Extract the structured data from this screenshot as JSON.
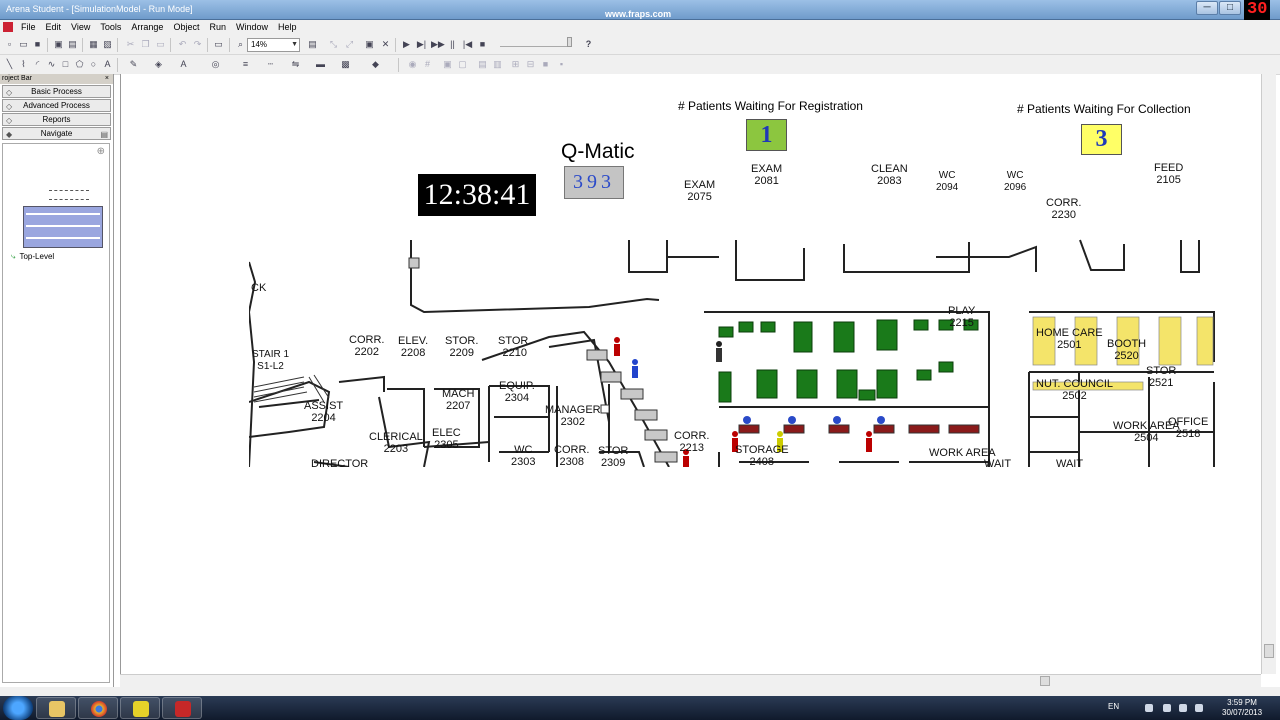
{
  "window": {
    "title": "Arena Student - [SimulationModel - Run Mode]",
    "overlay": "www.fraps.com",
    "fps": "30",
    "minimize": "─",
    "maximize": "□",
    "close": "✕"
  },
  "menu": [
    "File",
    "Edit",
    "View",
    "Tools",
    "Arrange",
    "Object",
    "Run",
    "Window",
    "Help"
  ],
  "toolbar": {
    "zoom": "14%",
    "help_icon": "?"
  },
  "project_bar": {
    "header": "roject Bar",
    "close": "×",
    "panels": [
      "Basic Process",
      "Advanced Process",
      "Reports",
      "Navigate"
    ],
    "tree_item": "Top-Level"
  },
  "animation": {
    "clock": "12:38:41",
    "qmatic_label": "Q-Matic",
    "qmatic_number": "393",
    "registration_label": "# Patients Waiting For Registration",
    "registration_count": "1",
    "collection_label": "# Patients Waiting For Collection",
    "collection_count": "3"
  },
  "rooms": [
    {
      "name": "EXAM",
      "num": "2081"
    },
    {
      "name": "EXAM",
      "num": "2075"
    },
    {
      "name": "CLEAN",
      "num": "2083"
    },
    {
      "name": "WC",
      "num": "2094"
    },
    {
      "name": "WC",
      "num": "2096"
    },
    {
      "name": "FEED",
      "num": "2105"
    },
    {
      "name": "CORR.",
      "num": "2230"
    },
    {
      "name": "CORR.",
      "num": "2202"
    },
    {
      "name": "ELEV.",
      "num": "2208"
    },
    {
      "name": "STOR.",
      "num": "2209"
    },
    {
      "name": "STOR.",
      "num": "2210"
    },
    {
      "name": "STAIR 1",
      "num": "S1-L2"
    },
    {
      "name": "ASSIST",
      "num": "2204"
    },
    {
      "name": "MACH",
      "num": "2207"
    },
    {
      "name": "EQUIP.",
      "num": "2304"
    },
    {
      "name": "MANAGER",
      "num": "2302"
    },
    {
      "name": "CLERICAL",
      "num": "2203"
    },
    {
      "name": "ELEC",
      "num": "2305"
    },
    {
      "name": "WC",
      "num": "2303"
    },
    {
      "name": "CORR.",
      "num": "2308"
    },
    {
      "name": "STOR",
      "num": "2309"
    },
    {
      "name": "CORR.",
      "num": "2213"
    },
    {
      "name": "STORAGE",
      "num": "2408"
    },
    {
      "name": "PLAY",
      "num": "2215"
    },
    {
      "name": "HOME CARE",
      "num": "2501"
    },
    {
      "name": "BOOTH",
      "num": "2520"
    },
    {
      "name": "STOR",
      "num": "2521"
    },
    {
      "name": "NUT. COUNCIL",
      "num": "2502"
    },
    {
      "name": "WORK AREA",
      "num": "2504"
    },
    {
      "name": "OFFICE",
      "num": "2518"
    },
    {
      "name": "DIRECTOR",
      "num": ""
    },
    {
      "name": "WORK AREA",
      "num": ""
    },
    {
      "name": "WAIT",
      "num": ""
    },
    {
      "name": "WAIT",
      "num": ""
    },
    {
      "name": "CK",
      "num": ""
    }
  ],
  "taskbar": {
    "lang": "EN",
    "time": "3:59 PM",
    "date": "30/07/2013"
  }
}
